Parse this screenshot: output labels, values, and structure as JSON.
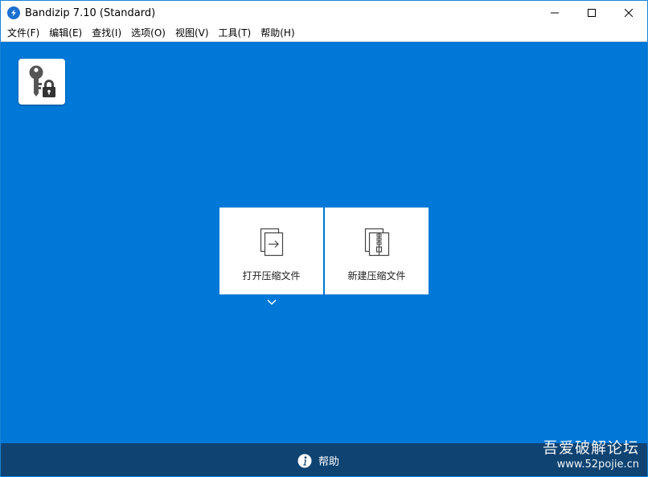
{
  "window": {
    "title": "Bandizip 7.10 (Standard)",
    "controls": {
      "minimize": "minimize",
      "maximize": "maximize",
      "close": "close"
    }
  },
  "menu": [
    {
      "label": "文件(F)"
    },
    {
      "label": "编辑(E)"
    },
    {
      "label": "查找(I)"
    },
    {
      "label": "选项(O)"
    },
    {
      "label": "视图(V)"
    },
    {
      "label": "工具(T)"
    },
    {
      "label": "帮助(H)"
    }
  ],
  "main": {
    "password_manager_icon": "key-lock-icon",
    "tiles": {
      "open": {
        "label": "打开压缩文件",
        "icon": "open-archive-icon"
      },
      "new": {
        "label": "新建压缩文件",
        "icon": "new-archive-icon"
      }
    },
    "dropdown_icon": "chevron-down-icon"
  },
  "footer": {
    "help_label": "帮助",
    "help_icon": "info-icon"
  },
  "watermark": {
    "line1": "吾爱破解论坛",
    "line2": "www.52pojie.cn"
  },
  "colors": {
    "accent": "#0078d7",
    "footer": "#0e4372",
    "tile": "#ffffff"
  }
}
